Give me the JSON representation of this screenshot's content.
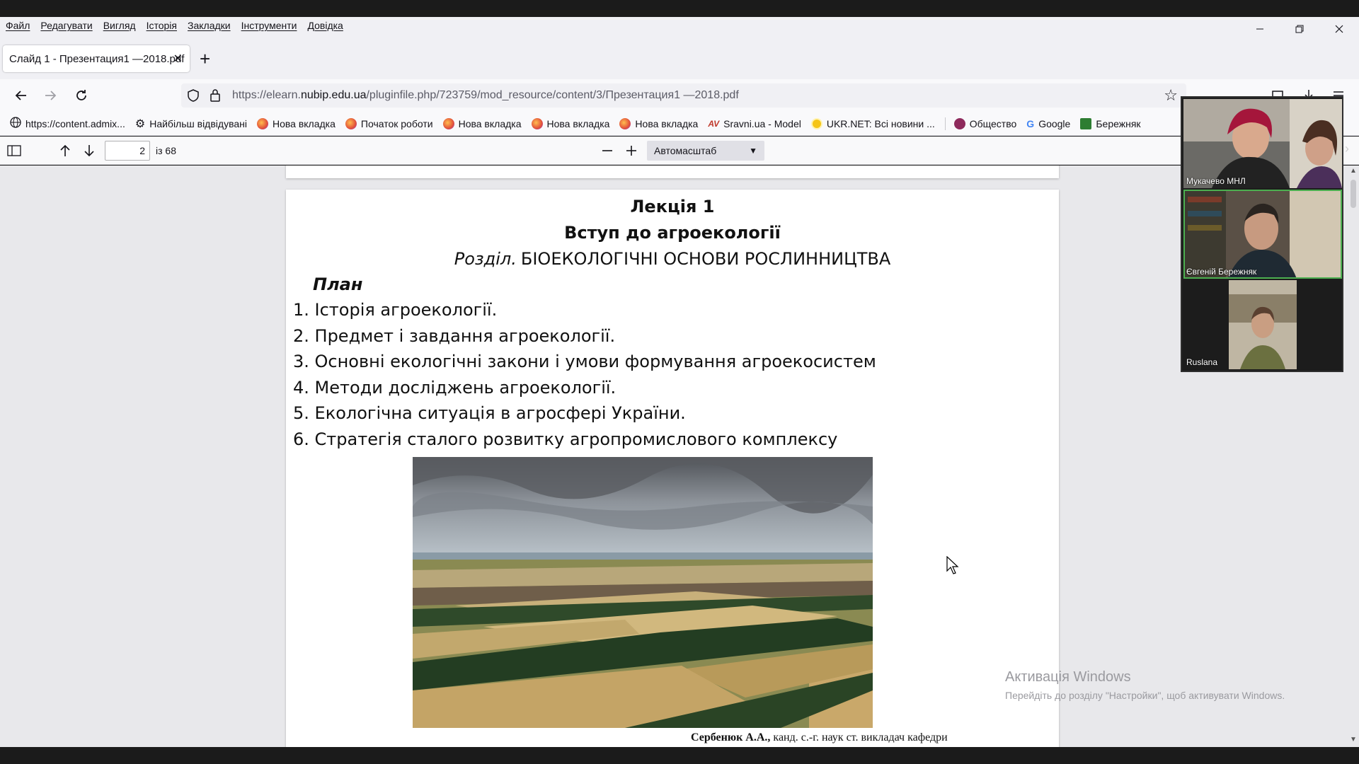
{
  "menubar": {
    "items": [
      "Файл",
      "Редагувати",
      "Вигляд",
      "Історія",
      "Закладки",
      "Інструменти",
      "Довідка"
    ]
  },
  "tab": {
    "title": "Слайд 1 - Презентация1 —2018.pdf",
    "close": "✕",
    "new_tab": "+"
  },
  "url": {
    "prefix": "https://elearn.",
    "domain": "nubip.edu.ua",
    "path": "/pluginfile.php/723759/mod_resource/content/3/Презентация1 —2018.pdf"
  },
  "bookmarks": [
    {
      "label": "https://content.admix...",
      "icon": "globe-icon",
      "color": "#5b5b66"
    },
    {
      "label": "Найбільш відвідувані",
      "icon": "gear-icon",
      "color": "#15141a"
    },
    {
      "label": "Нова вкладка",
      "icon": "firefox-icon",
      "color": "#e2503a"
    },
    {
      "label": "Початок роботи",
      "icon": "firefox-icon",
      "color": "#e2503a"
    },
    {
      "label": "Нова вкладка",
      "icon": "firefox-icon",
      "color": "#e2503a"
    },
    {
      "label": "Нова вкладка",
      "icon": "firefox-icon",
      "color": "#e2503a"
    },
    {
      "label": "Нова вкладка",
      "icon": "firefox-icon",
      "color": "#e2503a"
    },
    {
      "label": "Sravni.ua - Model",
      "icon": "sravni-icon",
      "color": "#c0392b"
    },
    {
      "label": "UKR.NET: Всі новини ...",
      "icon": "ukrnet-icon",
      "color": "#f5c518"
    },
    {
      "label": "Общество",
      "icon": "obshchestvo-icon",
      "color": "#8e2a5c"
    },
    {
      "label": "Google",
      "icon": "google-icon",
      "color": "#4285f4"
    },
    {
      "label": "Бережняк",
      "icon": "shield-icon",
      "color": "#2e7d32"
    }
  ],
  "pdf_toolbar": {
    "current_page": "2",
    "page_count": "із 68",
    "zoom": "Автомасштаб"
  },
  "slide": {
    "title": "Лекція 1",
    "subtitle": "Вступ до агроекології",
    "section_label": "Розділ.",
    "section_title": "БІОЕКОЛОГІЧНІ ОСНОВИ РОСЛИННИЦТВА",
    "plan_label": "План",
    "plan": [
      "1. Історія агроекології.",
      "2. Предмет і завдання агроекології.",
      "3. Основні екологічні закони і умови формування агроекосистем",
      "4. Методи досліджень агроекології.",
      "5. Екологічна ситуація в агросфері України.",
      "6. Стратегія сталого розвитку агропромислового комплексу"
    ],
    "author_name": "Сербенюк А.А.,",
    "author_role": "канд. с.-г. наук ст. викладач кафедри"
  },
  "watermark": {
    "title": "Активація Windows",
    "subtitle": "Перейдіть до розділу \"Настройки\", щоб активувати Windows."
  },
  "video": {
    "participants": [
      {
        "name": "Мукачево МНЛ"
      },
      {
        "name": "Євгеній Бережняк"
      },
      {
        "name": "Ruslana"
      }
    ]
  }
}
